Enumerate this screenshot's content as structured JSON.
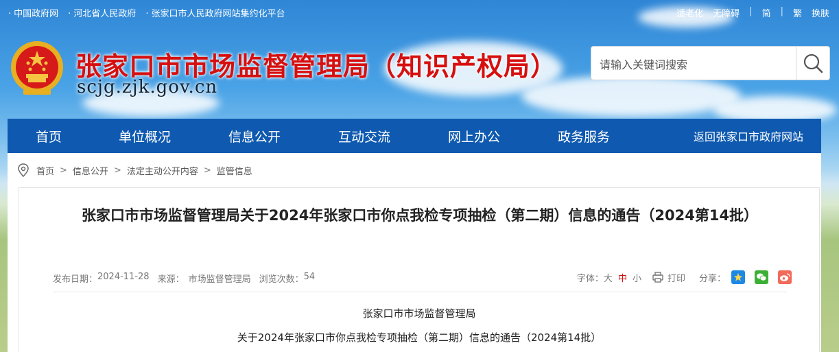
{
  "topbar": {
    "links": [
      "中国政府网",
      "河北省人民政府",
      "张家口市人民政府网站集约化平台"
    ],
    "right": [
      "适老化",
      "无障碍",
      "简",
      "繁",
      "换肤"
    ]
  },
  "header": {
    "title": "张家口市市场监督管理局（知识产权局）",
    "domain": "scjg.zjk.gov.cn",
    "search_placeholder": "请输入关键词搜索"
  },
  "nav": {
    "items": [
      "首页",
      "单位概况",
      "信息公开",
      "互动交流",
      "网上办公",
      "政务服务"
    ],
    "back": "返回张家口市政府网站"
  },
  "breadcrumb": [
    "首页",
    "信息公开",
    "法定主动公开内容",
    "监管信息"
  ],
  "article": {
    "title": "张家口市市场监督管理局关于2024年张家口市你点我检专项抽检（第二期）信息的通告（2024第14批）",
    "meta": {
      "date_label": "发布日期：",
      "date": "2024-11-28",
      "source_label": "来源：",
      "source": "市场监督管理局",
      "views_label": "浏览次数：",
      "views": "54"
    },
    "tools": {
      "font_label": "字体：",
      "font_large": "大",
      "font_medium": "中",
      "font_small": "小",
      "print": "打印",
      "share_label": "分享："
    },
    "body_line1": "张家口市市场监督管理局",
    "body_line2": "关于2024年张家口市你点我检专项抽检（第二期）信息的通告（2024第14批）"
  },
  "colors": {
    "nav_bg": "#0f5ab0",
    "title_red": "#d60f0f",
    "accent_red": "#d60f0f"
  }
}
